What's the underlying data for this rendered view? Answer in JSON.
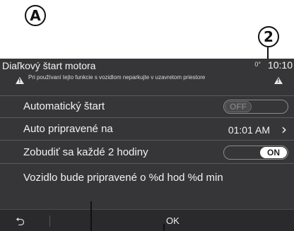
{
  "callouts": {
    "a": "A",
    "b": "2"
  },
  "header": {
    "title": "Diaľkový štart motora",
    "temp": "0°",
    "clock": "10:10",
    "warning": "Pri používaní tejto funkcie s vozidlom neparkujte v uzavretom priestore"
  },
  "rows": {
    "auto_start": {
      "label": "Automatický štart",
      "toggle": "OFF"
    },
    "ready_at": {
      "label": "Auto pripravené na",
      "value": "01:01 AM"
    },
    "wake": {
      "label": "Zobudiť sa každé 2 hodiny",
      "toggle": "ON"
    },
    "info": {
      "label": "Vozidlo bude pripravené o %d hod %d min"
    }
  },
  "footer": {
    "ok_label": "OK"
  }
}
